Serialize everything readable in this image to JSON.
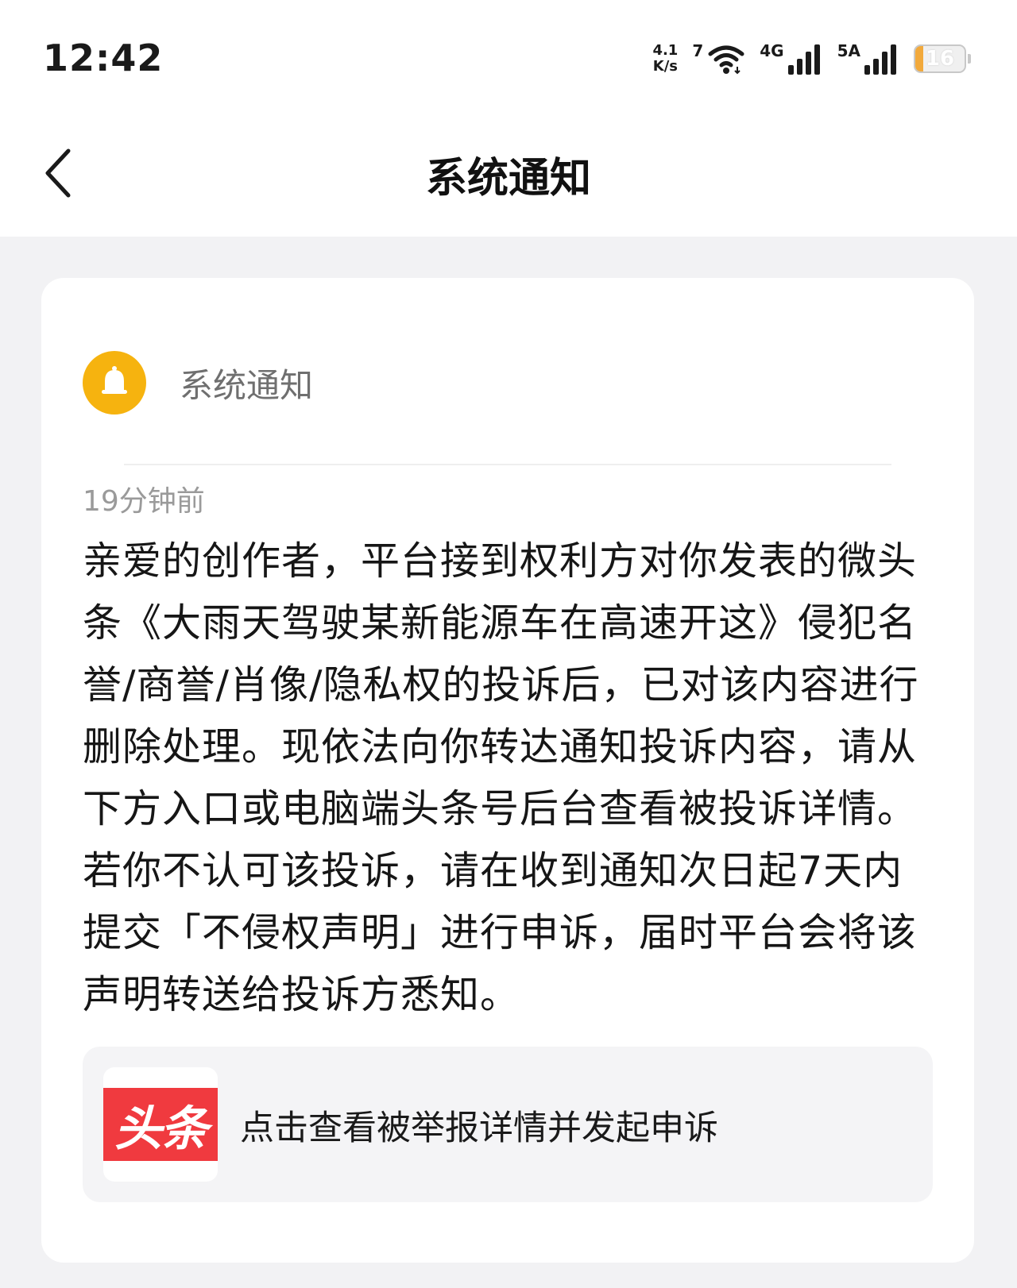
{
  "status_bar": {
    "time": "12:42",
    "net_speed_value": "4.1",
    "net_speed_unit": "K/s",
    "wifi_label": "7",
    "sim1_label": "4G",
    "sim2_label": "5A",
    "battery_level": "16"
  },
  "nav": {
    "title": "系统通知"
  },
  "notification": {
    "sender": "系统通知",
    "time_ago": "19分钟前",
    "body": "亲爱的创作者，平台接到权利方对你发表的微头条《大雨天驾驶某新能源车在高速开这》侵犯名誉/商誉/肖像/隐私权的投诉后，已对该内容进行删除处理。现依法向你转达通知投诉内容，请从下方入口或电脑端头条号后台查看被投诉详情。若你不认可该投诉，请在收到通知次日起7天内提交「不侵权声明」进行申诉，届时平台会将该声明转送给投诉方悉知。",
    "action": {
      "logo_text": "头条",
      "label": "点击查看被举报详情并发起申诉"
    }
  },
  "colors": {
    "accent_yellow": "#f6b30f",
    "brand_red": "#f03a3f",
    "battery_orange": "#f2a93b",
    "page_bg": "#f2f2f4"
  },
  "icons": {
    "back": "chevron-left-icon",
    "bell": "bell-icon",
    "wifi": "wifi-icon",
    "signal": "signal-bars-icon",
    "battery": "battery-icon"
  }
}
